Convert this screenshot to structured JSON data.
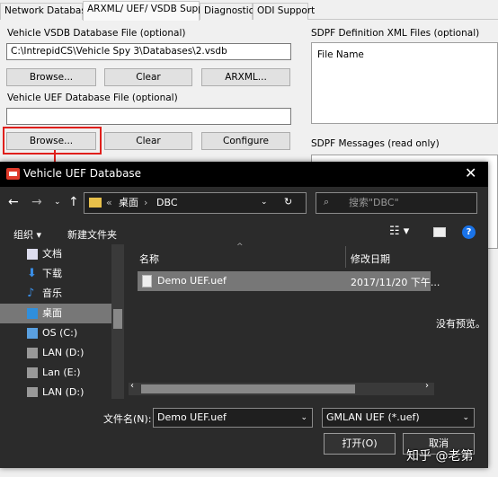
{
  "tabs": [
    "Network Databases",
    "ARXML/ UEF/ VSDB Support",
    "Diagnostics",
    "ODI Support"
  ],
  "vsdb": {
    "label": "Vehicle VSDB Database File (optional)",
    "value": "C:\\IntrepidCS\\Vehicle Spy 3\\Databases\\2.vsdb"
  },
  "buttons": {
    "browse1": "Browse...",
    "clear1": "Clear",
    "arxml": "ARXML...",
    "browse2": "Browse...",
    "clear2": "Clear",
    "configure": "Configure"
  },
  "uef": {
    "label": "Vehicle UEF Database File (optional)",
    "value": ""
  },
  "sdpf": {
    "label": "SDPF Definition XML Files (optional)",
    "col": "File Name",
    "messages_label": "SDPF Messages (read only)"
  },
  "dialog": {
    "title": "Vehicle UEF Database",
    "breadcrumb": {
      "sep": "«",
      "parent": "桌面",
      "current": "DBC"
    },
    "search_placeholder": "搜索\"DBC\"",
    "organize": "组织",
    "new_folder": "新建文件夹",
    "nav": [
      "文档",
      "下载",
      "音乐",
      "桌面",
      "OS (C:)",
      "LAN (D:)",
      "Lan (E:)",
      "LAN (D:)"
    ],
    "columns": {
      "name": "名称",
      "date": "修改日期"
    },
    "files": [
      {
        "name": "Demo UEF.uef",
        "date": "2017/11/20 下午..."
      }
    ],
    "no_preview": "没有预览。",
    "filename_label": "文件名(N):",
    "filename_value": "Demo UEF.uef",
    "filter": "GMLAN UEF (*.uef)",
    "open": "打开(O)",
    "cancel": "取消"
  },
  "watermark": "知乎 @老第",
  "colors": {
    "highlight": "#e0201c",
    "dialog_bg": "#2b2b2b",
    "selected": "#777777"
  }
}
